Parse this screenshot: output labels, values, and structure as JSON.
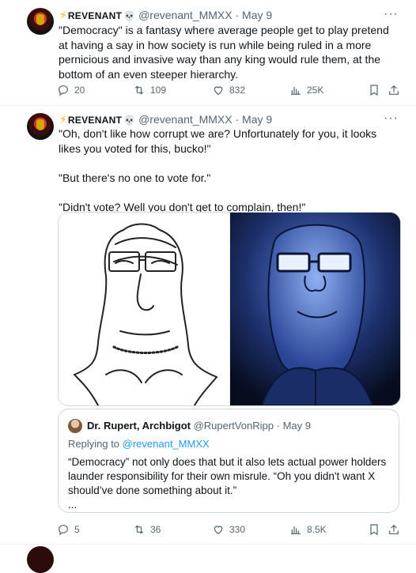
{
  "tweet1": {
    "name": "REVENANT",
    "handle": "@revenant_MMXX",
    "date": "May 9",
    "text": "\"Democracy\" is a fantasy where average people get to play pretend at having a say in how society is run while being ruled in a more pernicious and invasive way than any king would rule them, at the bottom of an even steeper hierarchy.",
    "replies": "20",
    "reposts": "109",
    "likes": "832",
    "views": "25K"
  },
  "tweet2": {
    "name": "REVENANT",
    "handle": "@revenant_MMXX",
    "date": "May 9",
    "text": "\"Oh, don't like how corrupt we are? Unfortunately for you, it looks likes you voted for this, bucko!\"\n\n\"But there's no one to vote for.\"\n\n\"Didn't vote? Well you don't get to complain, then!\"",
    "replies": "5",
    "reposts": "36",
    "likes": "330",
    "views": "8.5K",
    "quote": {
      "name": "Dr. Rupert, Archbigot",
      "handle": "@RupertVonRipp",
      "date": "May 9",
      "replying_prefix": "Replying to ",
      "replying_to": "@revenant_MMXX",
      "text": "“Democracy” not only does that but it also lets actual power holders launder responsibility for their own misrule. “Oh you didn't want X should’ve done something about it.”\n..."
    }
  },
  "icons": {
    "reply": "reply-icon",
    "repost": "repost-icon",
    "like": "like-icon",
    "views": "views-icon",
    "bookmark": "bookmark-icon",
    "share": "share-icon",
    "more": "more-icon"
  }
}
